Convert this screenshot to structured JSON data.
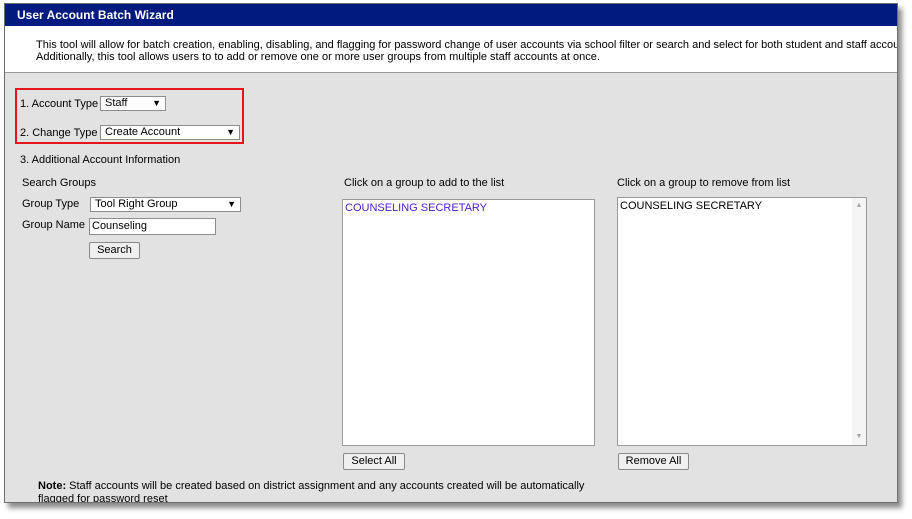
{
  "window": {
    "title": "User Account Batch Wizard"
  },
  "description": {
    "line1": "This tool will allow for batch creation, enabling, disabling, and flagging for password change of user accounts via school filter or search and select for both student and staff accounts.",
    "line2": "Additionally, this tool allows users to to add or remove one or more user groups from multiple staff accounts at once."
  },
  "form": {
    "account_type_label": "1. Account Type",
    "account_type_value": "Staff",
    "change_type_label": "2. Change Type",
    "change_type_value": "Create Account",
    "additional_info_label": "3. Additional Account Information"
  },
  "search": {
    "heading": "Search Groups",
    "group_type_label": "Group Type",
    "group_type_value": "Tool Right Group",
    "group_name_label": "Group Name",
    "group_name_value": "Counseling",
    "search_button": "Search"
  },
  "add_list": {
    "heading": "Click on a group to add to the list",
    "items": [
      "COUNSELING SECRETARY"
    ],
    "select_all_button": "Select All"
  },
  "remove_list": {
    "heading": "Click on a group to remove from list",
    "items": [
      "COUNSELING SECRETARY"
    ],
    "remove_all_button": "Remove All"
  },
  "note": {
    "label": "Note:",
    "text": " Staff accounts will be created based on district assignment and any accounts created will be automatically flagged for password reset"
  },
  "icons": {
    "dropdown": "triangle-down-icon",
    "scroll_up": "triangle-up-icon",
    "scroll_down": "triangle-down-icon"
  },
  "colors": {
    "title_bar": "#001a80",
    "highlight_border": "#e8141c",
    "add_list_text": "#4b1bd6"
  }
}
